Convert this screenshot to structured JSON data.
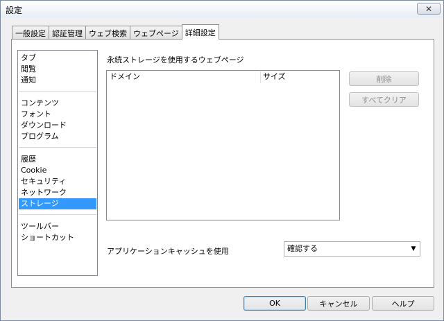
{
  "window": {
    "title": "設定",
    "close_glyph": "✕"
  },
  "tabs": [
    {
      "label": "一般設定",
      "active": false
    },
    {
      "label": "認証管理",
      "active": false
    },
    {
      "label": "ウェブ検索",
      "active": false
    },
    {
      "label": "ウェブページ",
      "active": false
    },
    {
      "label": "詳細設定",
      "active": true
    }
  ],
  "sidebar": {
    "items": [
      {
        "label": "タブ"
      },
      {
        "label": "閲覧"
      },
      {
        "label": "通知"
      },
      {
        "label": "コンテンツ"
      },
      {
        "label": "フォント"
      },
      {
        "label": "ダウンロード"
      },
      {
        "label": "プログラム"
      },
      {
        "label": "履歴"
      },
      {
        "label": "Cookie"
      },
      {
        "label": "セキュリティ"
      },
      {
        "label": "ネットワーク"
      },
      {
        "label": "ストレージ",
        "selected": true
      },
      {
        "label": "ツールバー"
      },
      {
        "label": "ショートカット"
      }
    ]
  },
  "storage": {
    "section_label": "永続ストレージを使用するウェブページ",
    "columns": {
      "domain": "ドメイン",
      "size": "サイズ"
    },
    "rows": [],
    "delete_label": "削除",
    "clear_all_label": "すべてクリア"
  },
  "app_cache": {
    "label": "アプリケーションキャッシュを使用",
    "selected": "確認する",
    "arrow_glyph": "▼"
  },
  "footer": {
    "ok_label": "OK",
    "cancel_label": "キャンセル",
    "help_label": "ヘルプ"
  }
}
